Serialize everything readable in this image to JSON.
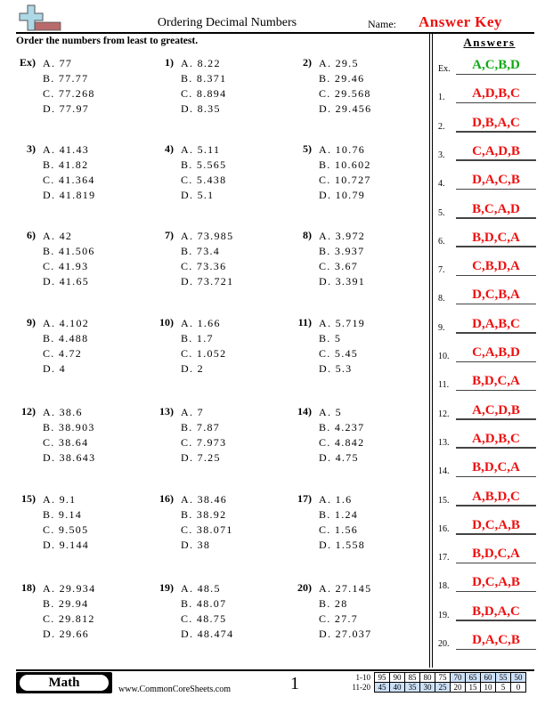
{
  "header": {
    "title": "Ordering Decimal Numbers",
    "name_label": "Name:",
    "name_value": "Answer Key",
    "logo_icon": "plus-minus-icon"
  },
  "instructions": "Order the numbers from least to greatest.",
  "problems": [
    {
      "num": "Ex)",
      "options": [
        "A. 77",
        "B. 77.77",
        "C. 77.268",
        "D. 77.97"
      ]
    },
    {
      "num": "1)",
      "options": [
        "A. 8.22",
        "B. 8.371",
        "C. 8.894",
        "D. 8.35"
      ]
    },
    {
      "num": "2)",
      "options": [
        "A. 29.5",
        "B. 29.46",
        "C. 29.568",
        "D. 29.456"
      ]
    },
    {
      "num": "3)",
      "options": [
        "A. 41.43",
        "B. 41.82",
        "C. 41.364",
        "D. 41.819"
      ]
    },
    {
      "num": "4)",
      "options": [
        "A. 5.11",
        "B. 5.565",
        "C. 5.438",
        "D. 5.1"
      ]
    },
    {
      "num": "5)",
      "options": [
        "A. 10.76",
        "B. 10.602",
        "C. 10.727",
        "D. 10.79"
      ]
    },
    {
      "num": "6)",
      "options": [
        "A. 42",
        "B. 41.506",
        "C. 41.93",
        "D. 41.65"
      ]
    },
    {
      "num": "7)",
      "options": [
        "A. 73.985",
        "B. 73.4",
        "C. 73.36",
        "D. 73.721"
      ]
    },
    {
      "num": "8)",
      "options": [
        "A. 3.972",
        "B. 3.937",
        "C. 3.67",
        "D. 3.391"
      ]
    },
    {
      "num": "9)",
      "options": [
        "A. 4.102",
        "B. 4.488",
        "C. 4.72",
        "D. 4"
      ]
    },
    {
      "num": "10)",
      "options": [
        "A. 1.66",
        "B. 1.7",
        "C. 1.052",
        "D. 2"
      ]
    },
    {
      "num": "11)",
      "options": [
        "A. 5.719",
        "B. 5",
        "C. 5.45",
        "D. 5.3"
      ]
    },
    {
      "num": "12)",
      "options": [
        "A. 38.6",
        "B. 38.903",
        "C. 38.64",
        "D. 38.643"
      ]
    },
    {
      "num": "13)",
      "options": [
        "A. 7",
        "B. 7.87",
        "C. 7.973",
        "D. 7.25"
      ]
    },
    {
      "num": "14)",
      "options": [
        "A. 5",
        "B. 4.237",
        "C. 4.842",
        "D. 4.75"
      ]
    },
    {
      "num": "15)",
      "options": [
        "A. 9.1",
        "B. 9.14",
        "C. 9.505",
        "D. 9.144"
      ]
    },
    {
      "num": "16)",
      "options": [
        "A. 38.46",
        "B. 38.92",
        "C. 38.071",
        "D. 38"
      ]
    },
    {
      "num": "17)",
      "options": [
        "A. 1.6",
        "B. 1.24",
        "C. 1.56",
        "D. 1.558"
      ]
    },
    {
      "num": "18)",
      "options": [
        "A. 29.934",
        "B. 29.94",
        "C. 29.812",
        "D. 29.66"
      ]
    },
    {
      "num": "19)",
      "options": [
        "A. 48.5",
        "B. 48.07",
        "C. 48.75",
        "D. 48.474"
      ]
    },
    {
      "num": "20)",
      "options": [
        "A. 27.145",
        "B. 28",
        "C. 27.7",
        "D. 27.037"
      ]
    }
  ],
  "answers": {
    "title": "Answers",
    "items": [
      {
        "label": "Ex.",
        "value": "A,C,B,D",
        "example": true
      },
      {
        "label": "1.",
        "value": "A,D,B,C"
      },
      {
        "label": "2.",
        "value": "D,B,A,C"
      },
      {
        "label": "3.",
        "value": "C,A,D,B"
      },
      {
        "label": "4.",
        "value": "D,A,C,B"
      },
      {
        "label": "5.",
        "value": "B,C,A,D"
      },
      {
        "label": "6.",
        "value": "B,D,C,A"
      },
      {
        "label": "7.",
        "value": "C,B,D,A"
      },
      {
        "label": "8.",
        "value": "D,C,B,A"
      },
      {
        "label": "9.",
        "value": "D,A,B,C"
      },
      {
        "label": "10.",
        "value": "C,A,B,D"
      },
      {
        "label": "11.",
        "value": "B,D,C,A"
      },
      {
        "label": "12.",
        "value": "A,C,D,B"
      },
      {
        "label": "13.",
        "value": "A,D,B,C"
      },
      {
        "label": "14.",
        "value": "B,D,C,A"
      },
      {
        "label": "15.",
        "value": "A,B,D,C"
      },
      {
        "label": "16.",
        "value": "D,C,A,B"
      },
      {
        "label": "17.",
        "value": "B,D,C,A"
      },
      {
        "label": "18.",
        "value": "D,C,A,B"
      },
      {
        "label": "19.",
        "value": "B,D,A,C"
      },
      {
        "label": "20.",
        "value": "D,A,C,B"
      }
    ]
  },
  "footer": {
    "badge": "Math",
    "site": "www.CommonCoreSheets.com",
    "page": "1",
    "score_table": {
      "rows": [
        {
          "label": "1-10",
          "values": [
            "95",
            "90",
            "85",
            "80",
            "75",
            "70",
            "65",
            "60",
            "55",
            "50"
          ]
        },
        {
          "label": "11-20",
          "values": [
            "45",
            "40",
            "35",
            "30",
            "25",
            "20",
            "15",
            "10",
            "5",
            "0"
          ]
        }
      ],
      "highlight_color": "#cce0f8"
    }
  },
  "colors": {
    "answer_red": "#ee1111",
    "example_green": "#11aa11"
  }
}
